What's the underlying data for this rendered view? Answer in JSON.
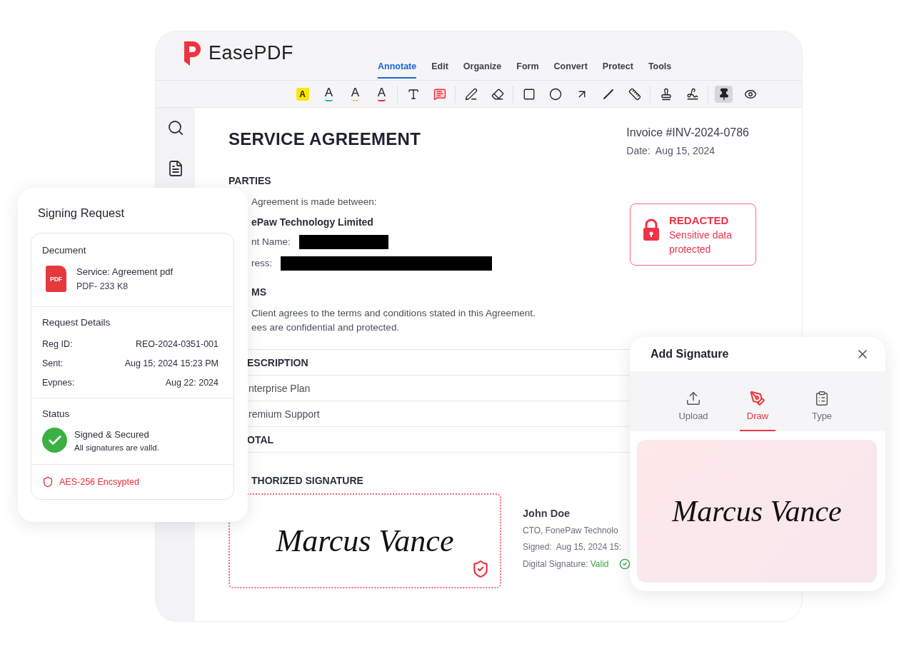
{
  "app": {
    "logo": "EasePDF"
  },
  "tabs": [
    {
      "label": "Annotate",
      "selected": true
    },
    {
      "label": "Edit",
      "selected": false
    },
    {
      "label": "Organize",
      "selected": false
    },
    {
      "label": "Form",
      "selected": false
    },
    {
      "label": "Convert",
      "selected": false
    },
    {
      "label": "Protect",
      "selected": false
    },
    {
      "label": "Tools",
      "selected": false
    }
  ],
  "toolbar": {
    "groups": [
      [
        {
          "kind": "highlight",
          "glyph": "A",
          "selected": false
        },
        {
          "kind": "underline",
          "glyph": "A",
          "selected": false
        },
        {
          "kind": "squiggly",
          "glyph": "A",
          "selected": false
        },
        {
          "kind": "strike",
          "glyph": "A",
          "selected": false
        }
      ],
      [
        {
          "kind": "text",
          "selected": false
        },
        {
          "kind": "comment",
          "selected": false
        }
      ],
      [
        {
          "kind": "pen",
          "selected": false
        },
        {
          "kind": "eraser",
          "selected": false
        }
      ],
      [
        {
          "kind": "rectangle",
          "selected": false
        },
        {
          "kind": "circle",
          "selected": false
        },
        {
          "kind": "arrow",
          "selected": false
        },
        {
          "kind": "line",
          "selected": false
        },
        {
          "kind": "measure",
          "selected": false
        }
      ],
      [
        {
          "kind": "stamp",
          "selected": false
        },
        {
          "kind": "signature",
          "selected": false
        }
      ],
      [
        {
          "kind": "pin",
          "selected": true
        },
        {
          "kind": "view",
          "selected": false
        }
      ]
    ]
  },
  "sidebar": {
    "items": [
      {
        "kind": "search"
      },
      {
        "kind": "document"
      }
    ]
  },
  "document": {
    "title": "SERVICE AGREEMENT",
    "invoice": "Invoice #INV-2024-0786",
    "date_label": "Date:",
    "date": "Aug 15, 2024",
    "parties_heading": "PARTIES",
    "parties_intro": "Agreement is made between:",
    "company": "ePaw Technology Limited",
    "redacted_fields": [
      {
        "label": "nt Name:"
      },
      {
        "label": "ress:"
      }
    ],
    "redaction_notice": {
      "title": "REDACTED",
      "text": "Sensitive data protected"
    },
    "terms_heading": "MS",
    "terms": [
      "Client agrees to the terms and conditions stated in this Agreement.",
      "ees are confidential and protected."
    ],
    "table": {
      "rows": [
        {
          "text": "ESCRIPTION",
          "header": true
        },
        {
          "text": "nterprise Plan",
          "header": false
        },
        {
          "text": "remium Support",
          "header": false
        },
        {
          "text": "OTAL",
          "header": true
        }
      ]
    },
    "signature_heading": "THORIZED SIGNATURE",
    "signature": "Marcus Vance",
    "signer": {
      "name": "John Doe",
      "role": "CTO, FonePaw Technolo",
      "signed_label": "Signed:",
      "signed": "Aug 15, 2024 15:",
      "digital_label": "Digital Signature:",
      "digital_status": "Valid"
    }
  },
  "signing_request": {
    "title": "Signing Request",
    "document_heading": "Decument",
    "file_badge": "PDF",
    "file_name": "Service: Agreement pdf",
    "file_meta": "PDF- 233 K8",
    "details_heading": "Request Details",
    "details": [
      {
        "label": "Reg ID:",
        "value": "REO-2024-0351-001"
      },
      {
        "label": "Sent:",
        "value": "Aug 15; 2024 15:23 PM"
      },
      {
        "label": "Evpnes:",
        "value": "Aug 22: 2024"
      }
    ],
    "status_heading": "Status",
    "status": "Signed & Secured",
    "status_note": "All signatures are valld.",
    "encryption": "AES-256 Encsypted"
  },
  "add_signature": {
    "title": "Add Signature",
    "tabs": [
      {
        "kind": "upload",
        "label": "Upload",
        "selected": false
      },
      {
        "kind": "draw",
        "label": "Draw",
        "selected": true
      },
      {
        "kind": "type",
        "label": "Type",
        "selected": false
      }
    ],
    "signature": "Marcus Vance"
  }
}
